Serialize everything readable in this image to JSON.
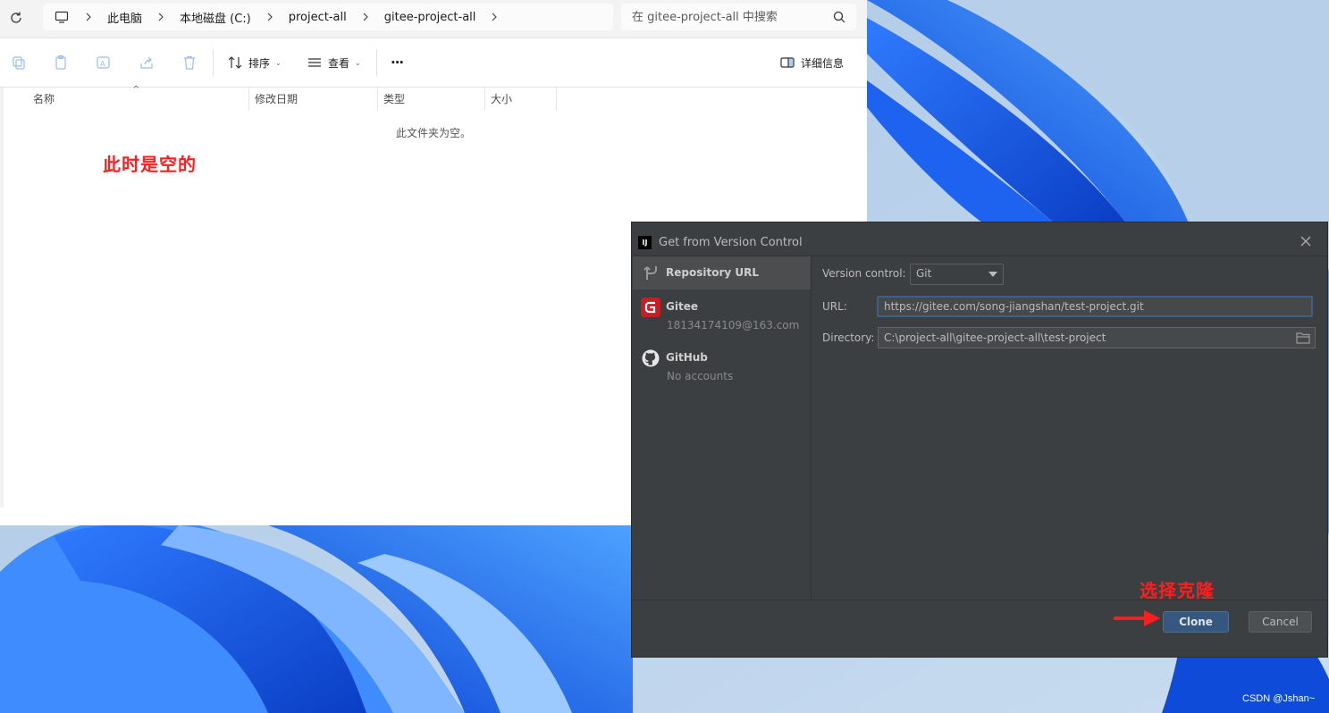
{
  "explorer": {
    "breadcrumb": [
      "此电脑",
      "本地磁盘 (C:)",
      "project-all",
      "gitee-project-all"
    ],
    "search_placeholder": "在 gitee-project-all 中搜索",
    "toolbar": {
      "sort_label": "排序",
      "view_label": "查看",
      "more_label": "···",
      "details_label": "详细信息"
    },
    "columns": [
      "名称",
      "修改日期",
      "类型",
      "大小"
    ],
    "empty_message": "此文件夹为空。",
    "annotation": "此时是空的"
  },
  "dialog": {
    "title": "Get from Version Control",
    "logo_text": "IJ",
    "sidebar": [
      {
        "name": "Repository URL",
        "sub": "",
        "icon": "repository-url-icon"
      },
      {
        "name": "Gitee",
        "sub": "18134174109@163.com",
        "icon": "gitee-icon"
      },
      {
        "name": "GitHub",
        "sub": "No accounts",
        "icon": "github-icon"
      }
    ],
    "version_control_label": "Version control:",
    "version_control_value": "Git",
    "url_label": "URL:",
    "url_value": "https://gitee.com/song-jiangshan/test-project.git",
    "directory_label": "Directory:",
    "directory_value": "C:\\project-all\\gitee-project-all\\test-project",
    "clone_label": "Clone",
    "cancel_label": "Cancel"
  },
  "annotations": {
    "clone_hint": "选择克隆"
  },
  "watermark": "CSDN @Jshan~",
  "colors": {
    "annotation_red": "#ff1e1e",
    "ide_bg": "#3c3f41",
    "clone_blue": "#365880",
    "wallpaper_blue": "#1a5fd8"
  }
}
